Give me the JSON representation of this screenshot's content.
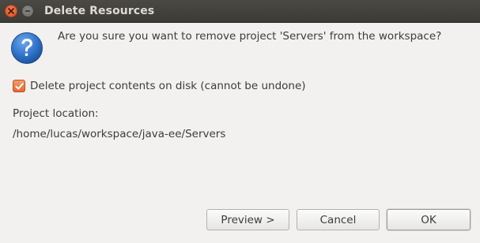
{
  "window": {
    "title": "Delete Resources"
  },
  "dialog": {
    "message": "Are you sure you want to remove project 'Servers' from the workspace?",
    "checkbox_label": "Delete project contents on disk (cannot be undone)",
    "checkbox_checked": true,
    "location_label": "Project location:",
    "location_value": "/home/lucas/workspace/java-ee/Servers",
    "icon": "question-icon"
  },
  "buttons": {
    "preview_label": "Preview >",
    "cancel_label": "Cancel",
    "ok_label": "OK"
  },
  "colors": {
    "titlebar": "#3c3b37",
    "accent": "#e5682e",
    "background": "#f2f1f0",
    "icon_blue": "#2a6fc9"
  }
}
